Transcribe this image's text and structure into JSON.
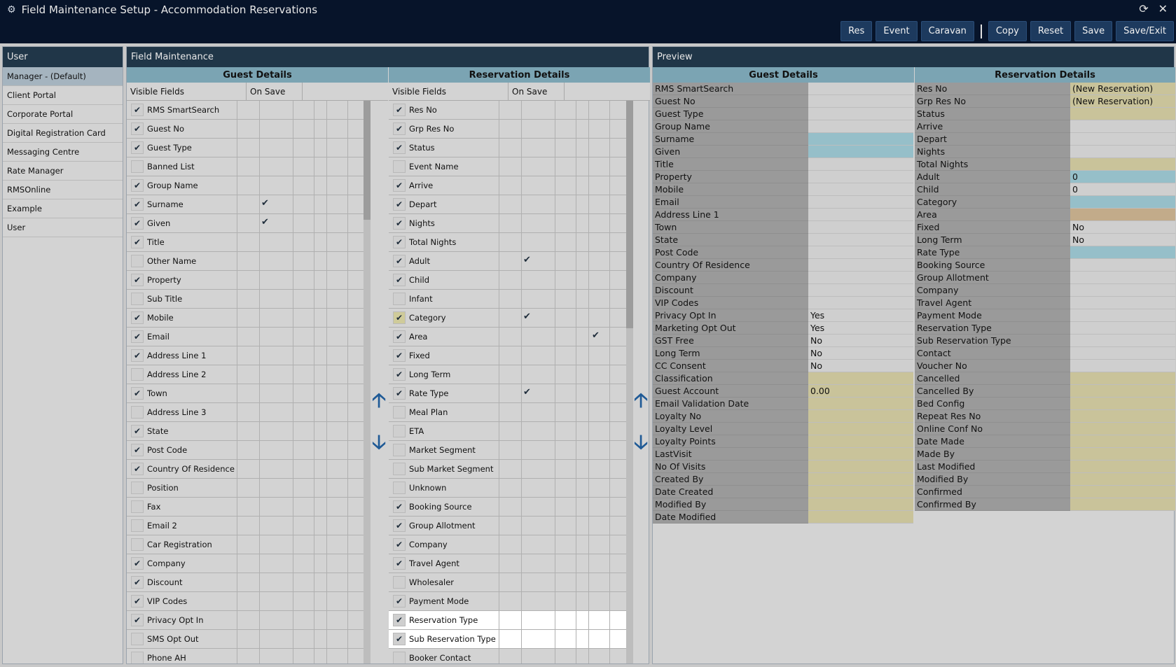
{
  "window": {
    "title": "Field Maintenance Setup - Accommodation Reservations",
    "icons": [
      "refresh-icon",
      "close-icon"
    ]
  },
  "toolbar": {
    "buttons": [
      "Res",
      "Event",
      "Caravan",
      "Copy",
      "Reset",
      "Save",
      "Save/Exit"
    ]
  },
  "user_panel": {
    "title": "User",
    "items": [
      "Manager - (Default)",
      "Client Portal",
      "Corporate Portal",
      "Digital Registration Card",
      "Messaging Centre",
      "Rate Manager",
      "RMSOnline",
      "Example",
      "User"
    ],
    "selected": "Manager - (Default)"
  },
  "field_maintenance": {
    "title": "Field Maintenance",
    "guest": {
      "header": "Guest Details",
      "col_visible": "Visible Fields",
      "col_onsave": "On Save",
      "rows": [
        {
          "label": "RMS SmartSearch",
          "visible": true,
          "onsave": false
        },
        {
          "label": "Guest No",
          "visible": true,
          "onsave": false
        },
        {
          "label": "Guest Type",
          "visible": true,
          "onsave": false
        },
        {
          "label": "Banned List",
          "visible": false,
          "onsave": false
        },
        {
          "label": "Group Name",
          "visible": true,
          "onsave": false
        },
        {
          "label": "Surname",
          "visible": true,
          "onsave": true
        },
        {
          "label": "Given",
          "visible": true,
          "onsave": true
        },
        {
          "label": "Title",
          "visible": true,
          "onsave": false
        },
        {
          "label": "Other Name",
          "visible": false,
          "onsave": false
        },
        {
          "label": "Property",
          "visible": true,
          "onsave": false
        },
        {
          "label": "Sub Title",
          "visible": false,
          "onsave": false
        },
        {
          "label": "Mobile",
          "visible": true,
          "onsave": false
        },
        {
          "label": "Email",
          "visible": true,
          "onsave": false
        },
        {
          "label": "Address Line 1",
          "visible": true,
          "onsave": false
        },
        {
          "label": "Address Line 2",
          "visible": false,
          "onsave": false
        },
        {
          "label": "Town",
          "visible": true,
          "onsave": false
        },
        {
          "label": "Address Line 3",
          "visible": false,
          "onsave": false
        },
        {
          "label": "State",
          "visible": true,
          "onsave": false
        },
        {
          "label": "Post Code",
          "visible": true,
          "onsave": false
        },
        {
          "label": "Country Of Residence",
          "visible": true,
          "onsave": false
        },
        {
          "label": "Position",
          "visible": false,
          "onsave": false
        },
        {
          "label": "Fax",
          "visible": false,
          "onsave": false
        },
        {
          "label": "Email 2",
          "visible": false,
          "onsave": false
        },
        {
          "label": "Car Registration",
          "visible": false,
          "onsave": false
        },
        {
          "label": "Company",
          "visible": true,
          "onsave": false
        },
        {
          "label": "Discount",
          "visible": true,
          "onsave": false
        },
        {
          "label": "VIP Codes",
          "visible": true,
          "onsave": false
        },
        {
          "label": "Privacy Opt In",
          "visible": true,
          "onsave": false
        },
        {
          "label": "SMS Opt Out",
          "visible": false,
          "onsave": false
        },
        {
          "label": "Phone AH",
          "visible": false,
          "onsave": false
        }
      ]
    },
    "reservation": {
      "header": "Reservation Details",
      "col_visible": "Visible Fields",
      "col_onsave": "On Save",
      "rows": [
        {
          "label": "Res No",
          "visible": true,
          "onsave": false,
          "extra": false
        },
        {
          "label": "Grp Res No",
          "visible": true,
          "onsave": false,
          "extra": false
        },
        {
          "label": "Status",
          "visible": true,
          "onsave": false,
          "extra": false
        },
        {
          "label": "Event Name",
          "visible": false,
          "onsave": false,
          "extra": false
        },
        {
          "label": "Arrive",
          "visible": true,
          "onsave": false,
          "extra": false
        },
        {
          "label": "Depart",
          "visible": true,
          "onsave": false,
          "extra": false
        },
        {
          "label": "Nights",
          "visible": true,
          "onsave": false,
          "extra": false
        },
        {
          "label": "Total Nights",
          "visible": true,
          "onsave": false,
          "extra": false
        },
        {
          "label": "Adult",
          "visible": true,
          "onsave": true,
          "extra": false
        },
        {
          "label": "Child",
          "visible": true,
          "onsave": false,
          "extra": false
        },
        {
          "label": "Infant",
          "visible": false,
          "onsave": false,
          "extra": false
        },
        {
          "label": "Category",
          "visible": true,
          "onsave": true,
          "extra": false,
          "hl": true
        },
        {
          "label": "Area",
          "visible": true,
          "onsave": false,
          "extra": true
        },
        {
          "label": "Fixed",
          "visible": true,
          "onsave": false,
          "extra": false
        },
        {
          "label": "Long Term",
          "visible": true,
          "onsave": false,
          "extra": false
        },
        {
          "label": "Rate Type",
          "visible": true,
          "onsave": true,
          "extra": false
        },
        {
          "label": "Meal Plan",
          "visible": false,
          "onsave": false,
          "extra": false
        },
        {
          "label": "ETA",
          "visible": false,
          "onsave": false,
          "extra": false
        },
        {
          "label": "Market Segment",
          "visible": false,
          "onsave": false,
          "extra": false
        },
        {
          "label": "Sub Market Segment",
          "visible": false,
          "onsave": false,
          "extra": false
        },
        {
          "label": "Unknown",
          "visible": false,
          "onsave": false,
          "extra": false
        },
        {
          "label": "Booking Source",
          "visible": true,
          "onsave": false,
          "extra": false
        },
        {
          "label": "Group Allotment",
          "visible": true,
          "onsave": false,
          "extra": false
        },
        {
          "label": "Company",
          "visible": true,
          "onsave": false,
          "extra": false
        },
        {
          "label": "Travel Agent",
          "visible": true,
          "onsave": false,
          "extra": false
        },
        {
          "label": "Wholesaler",
          "visible": false,
          "onsave": false,
          "extra": false
        },
        {
          "label": "Payment Mode",
          "visible": true,
          "onsave": false,
          "extra": false
        },
        {
          "label": "Reservation Type",
          "visible": true,
          "onsave": false,
          "extra": false
        },
        {
          "label": "Sub Reservation Type",
          "visible": true,
          "onsave": false,
          "extra": false
        },
        {
          "label": "Booker Contact",
          "visible": false,
          "onsave": false,
          "extra": false
        }
      ]
    },
    "arrows": [
      "arrow-up-icon",
      "arrow-down-icon"
    ]
  },
  "preview": {
    "title": "Preview",
    "guest": {
      "header": "Guest Details",
      "rows": [
        {
          "label": "RMS SmartSearch",
          "value": "",
          "style": ""
        },
        {
          "label": "Guest No",
          "value": "",
          "style": ""
        },
        {
          "label": "Guest Type",
          "value": "",
          "style": ""
        },
        {
          "label": "Group Name",
          "value": "",
          "style": ""
        },
        {
          "label": "Surname",
          "value": "",
          "style": "blue"
        },
        {
          "label": "Given",
          "value": "",
          "style": "blue"
        },
        {
          "label": "Title",
          "value": "",
          "style": ""
        },
        {
          "label": "Property",
          "value": "",
          "style": ""
        },
        {
          "label": "Mobile",
          "value": "",
          "style": ""
        },
        {
          "label": "Email",
          "value": "",
          "style": ""
        },
        {
          "label": "Address Line 1",
          "value": "",
          "style": ""
        },
        {
          "label": "Town",
          "value": "",
          "style": ""
        },
        {
          "label": "State",
          "value": "",
          "style": ""
        },
        {
          "label": "Post Code",
          "value": "",
          "style": ""
        },
        {
          "label": "Country Of Residence",
          "value": "",
          "style": ""
        },
        {
          "label": "Company",
          "value": "",
          "style": ""
        },
        {
          "label": "Discount",
          "value": "",
          "style": ""
        },
        {
          "label": "VIP Codes",
          "value": "",
          "style": ""
        },
        {
          "label": "Privacy Opt In",
          "value": "Yes",
          "style": ""
        },
        {
          "label": "Marketing Opt Out",
          "value": "Yes",
          "style": ""
        },
        {
          "label": "GST Free",
          "value": "No",
          "style": ""
        },
        {
          "label": "Long Term",
          "value": "No",
          "style": ""
        },
        {
          "label": "CC Consent",
          "value": "No",
          "style": ""
        },
        {
          "label": "Classification",
          "value": "",
          "style": "yellow"
        },
        {
          "label": "Guest Account",
          "value": "0.00",
          "style": "yellow"
        },
        {
          "label": "Email Validation Date",
          "value": "",
          "style": "yellow"
        },
        {
          "label": "Loyalty No",
          "value": "",
          "style": "yellow"
        },
        {
          "label": "Loyalty Level",
          "value": "",
          "style": "yellow"
        },
        {
          "label": "Loyalty Points",
          "value": "",
          "style": "yellow"
        },
        {
          "label": "LastVisit",
          "value": "",
          "style": "yellow"
        },
        {
          "label": "No Of Visits",
          "value": "",
          "style": "yellow"
        },
        {
          "label": "Created By",
          "value": "",
          "style": "yellow"
        },
        {
          "label": "Date Created",
          "value": "",
          "style": "yellow"
        },
        {
          "label": "Modified By",
          "value": "",
          "style": "yellow"
        },
        {
          "label": "Date Modified",
          "value": "",
          "style": "yellow"
        }
      ]
    },
    "reservation": {
      "header": "Reservation Details",
      "rows": [
        {
          "label": "Res No",
          "value": "(New Reservation)",
          "style": "yellow"
        },
        {
          "label": "Grp Res No",
          "value": "(New Reservation)",
          "style": "yellow"
        },
        {
          "label": "Status",
          "value": "",
          "style": "yellow"
        },
        {
          "label": "Arrive",
          "value": "",
          "style": ""
        },
        {
          "label": "Depart",
          "value": "",
          "style": ""
        },
        {
          "label": "Nights",
          "value": "",
          "style": ""
        },
        {
          "label": "Total Nights",
          "value": "",
          "style": "yellow"
        },
        {
          "label": "Adult",
          "value": "0",
          "style": "blue"
        },
        {
          "label": "Child",
          "value": "0",
          "style": ""
        },
        {
          "label": "Category",
          "value": "",
          "style": "blue"
        },
        {
          "label": "Area",
          "value": "",
          "style": "tan"
        },
        {
          "label": "Fixed",
          "value": "No",
          "style": ""
        },
        {
          "label": "Long Term",
          "value": "No",
          "style": ""
        },
        {
          "label": "Rate Type",
          "value": "",
          "style": "blue"
        },
        {
          "label": "Booking Source",
          "value": "",
          "style": ""
        },
        {
          "label": "Group Allotment",
          "value": "",
          "style": ""
        },
        {
          "label": "Company",
          "value": "",
          "style": ""
        },
        {
          "label": "Travel Agent",
          "value": "",
          "style": ""
        },
        {
          "label": "Payment Mode",
          "value": "",
          "style": ""
        },
        {
          "label": "Reservation Type",
          "value": "",
          "style": ""
        },
        {
          "label": "Sub Reservation Type",
          "value": "",
          "style": ""
        },
        {
          "label": "Contact",
          "value": "",
          "style": ""
        },
        {
          "label": "Voucher No",
          "value": "",
          "style": ""
        },
        {
          "label": "Cancelled",
          "value": "",
          "style": "yellow"
        },
        {
          "label": "Cancelled By",
          "value": "",
          "style": "yellow"
        },
        {
          "label": "Bed Config",
          "value": "",
          "style": "yellow"
        },
        {
          "label": "Repeat Res No",
          "value": "",
          "style": "yellow"
        },
        {
          "label": "Online Conf No",
          "value": "",
          "style": "yellow"
        },
        {
          "label": "Date Made",
          "value": "",
          "style": "yellow"
        },
        {
          "label": "Made By",
          "value": "",
          "style": "yellow"
        },
        {
          "label": "Last Modified",
          "value": "",
          "style": "yellow"
        },
        {
          "label": "Modified By",
          "value": "",
          "style": "yellow"
        },
        {
          "label": "Confirmed",
          "value": "",
          "style": "yellow"
        },
        {
          "label": "Confirmed By",
          "value": "",
          "style": "yellow"
        }
      ]
    }
  }
}
